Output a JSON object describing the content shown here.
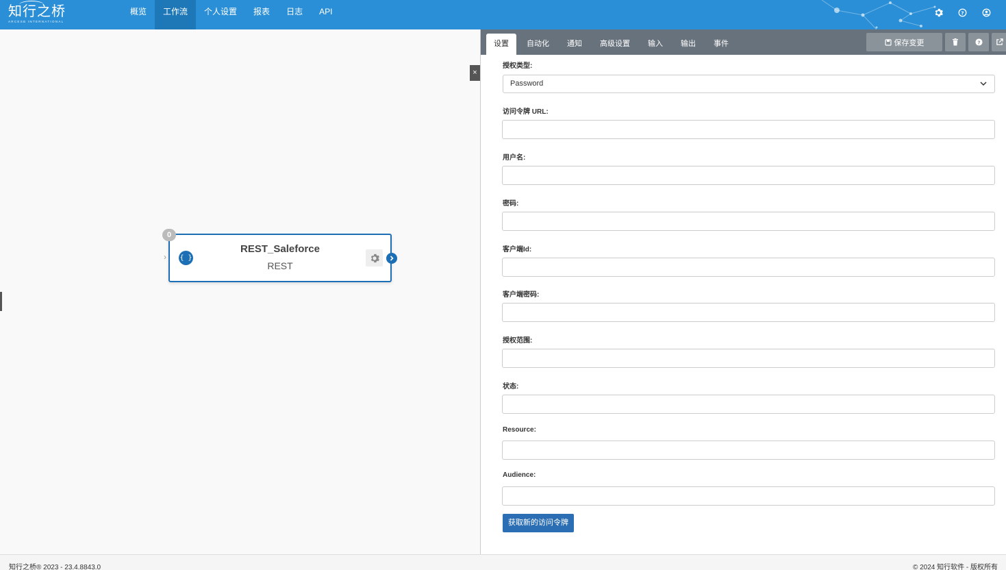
{
  "brand": {
    "logo_text": "知行之桥",
    "logo_sub": "ARCESB INTERNATIONAL"
  },
  "nav": {
    "items": [
      {
        "label": "概览",
        "active": false
      },
      {
        "label": "工作流",
        "active": true
      },
      {
        "label": "个人设置",
        "active": false
      },
      {
        "label": "报表",
        "active": false
      },
      {
        "label": "日志",
        "active": false
      },
      {
        "label": "API",
        "active": false
      }
    ]
  },
  "top_icons": [
    "gear-icon",
    "help-icon",
    "user-icon"
  ],
  "node": {
    "badge": "0",
    "title": "REST_Saleforce",
    "subtitle": "REST",
    "type_icon": "{ }"
  },
  "close_panel": "×",
  "panel": {
    "tabs": [
      "设置",
      "自动化",
      "通知",
      "高级设置",
      "输入",
      "输出",
      "事件"
    ],
    "active_tab": "设置",
    "save_label": "保存变更"
  },
  "form": {
    "auth_type_label": "授权类型:",
    "auth_type_value": "Password",
    "fields": [
      {
        "label": "访问令牌 URL:",
        "value": ""
      },
      {
        "label": "用户名:",
        "value": ""
      },
      {
        "label": "密码:",
        "value": ""
      },
      {
        "label": "客户端Id:",
        "value": ""
      },
      {
        "label": "客户端密码:",
        "value": ""
      },
      {
        "label": "授权范围:",
        "value": ""
      },
      {
        "label": "状态:",
        "value": ""
      },
      {
        "label": "Resource:",
        "value": ""
      },
      {
        "label": "Audience:",
        "value": ""
      }
    ],
    "submit_label": "获取新的访问令牌"
  },
  "footer": {
    "left": "知行之桥® 2023 - 23.4.8843.0",
    "right": "© 2024 知行软件 - 版权所有"
  },
  "colors": {
    "topbar": "#2a8fd6",
    "nav_active": "#1e78b8",
    "accent": "#1d6fb5",
    "tabbar": "#68727c",
    "button_primary": "#2c6eb3"
  }
}
